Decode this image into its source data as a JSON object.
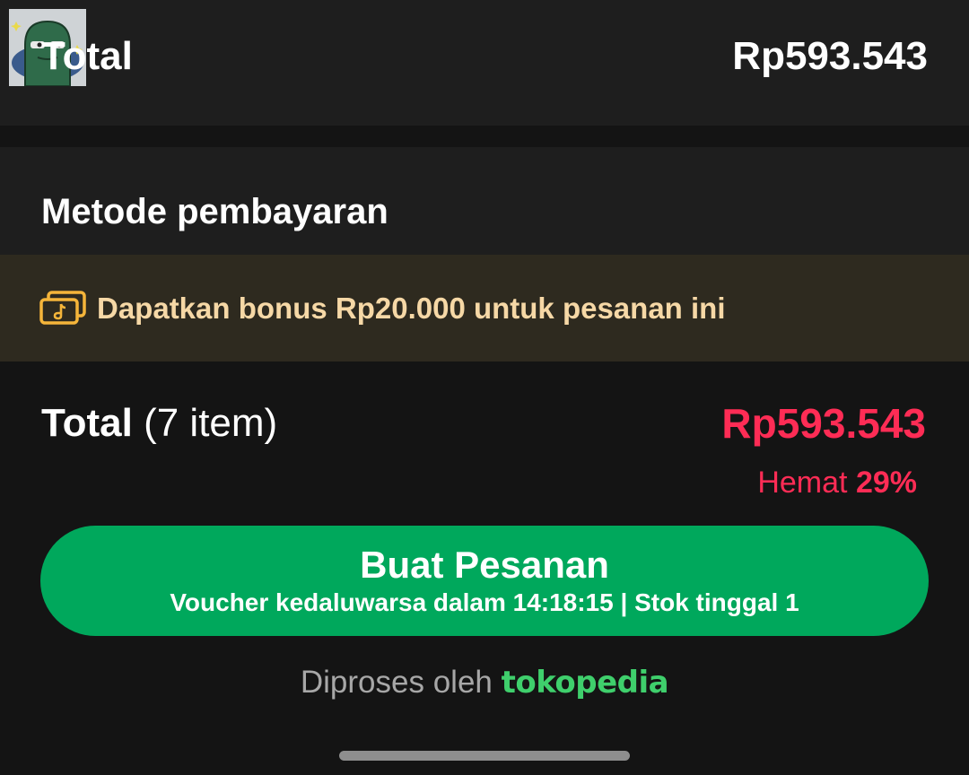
{
  "top_bar": {
    "total_label": "Total",
    "total_value": "Rp593.543"
  },
  "payment": {
    "title": "Metode pembayaran"
  },
  "bonus": {
    "icon": "tiktok-coupon-icon",
    "text": "Dapatkan bonus Rp20.000 untuk pesanan ini",
    "color": "#f6d8a6"
  },
  "summary": {
    "label": "Total",
    "count": "(7 item)",
    "total": "Rp593.543",
    "savings_label": "Hemat",
    "savings_pct": "29%",
    "accent_color": "#fe2c55"
  },
  "order_button": {
    "label": "Buat Pesanan",
    "sub": "Voucher kedaluwarsa dalam 14:18:15 | Stok tinggal 1",
    "color": "#00a85c"
  },
  "footer": {
    "processed_by": "Diproses oleh",
    "brand": "tokopedia"
  }
}
